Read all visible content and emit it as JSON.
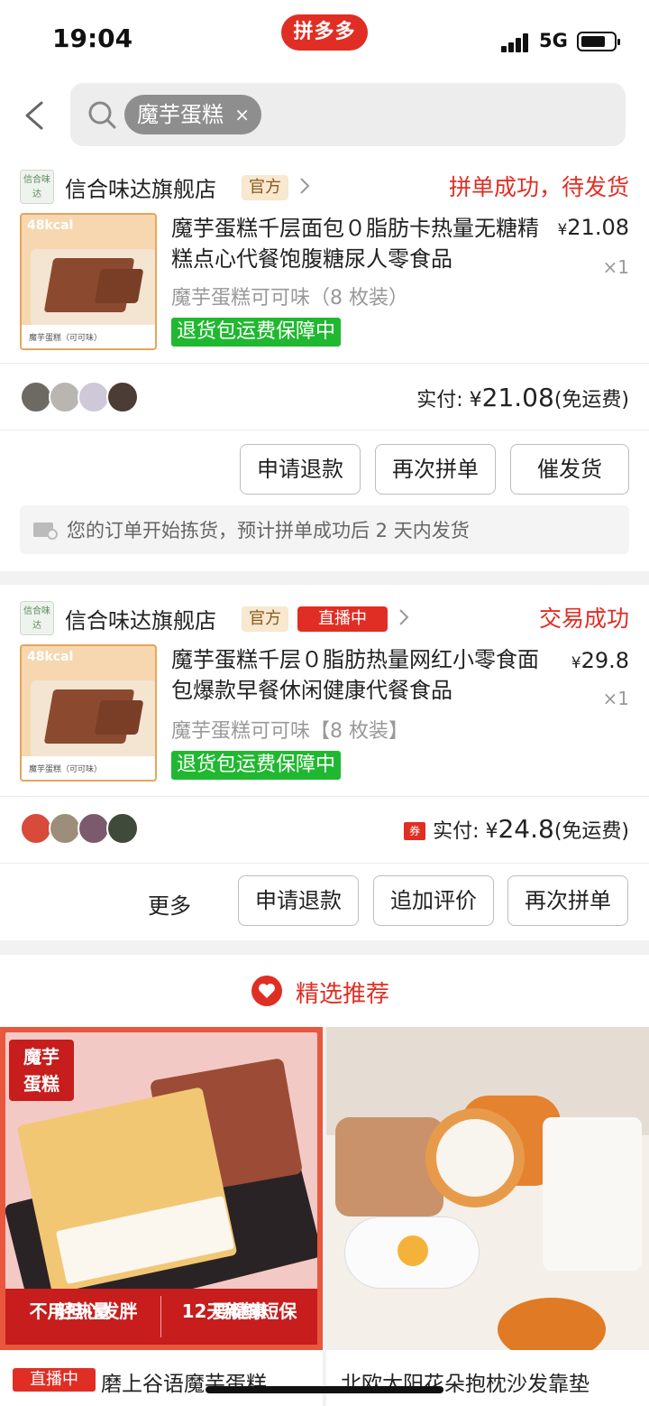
{
  "status_bar": {
    "time": "19:04",
    "app_badge": "拼多多",
    "network": "5G"
  },
  "search": {
    "chip_text": "魔芋蛋糕",
    "chip_clear": "×"
  },
  "orders": [
    {
      "store_name": "信合味达旗舰店",
      "store_logo_text": "信合味达",
      "official_tag": "官方",
      "status": "拼单成功，待发货",
      "image_kcal": "48kcal",
      "image_caption": "魔芋蛋糕（可可味）",
      "title": "魔芋蛋糕千层面包０脂肪卡热量无糖精糕点心代餐饱腹糖尿人零食品",
      "spec": "魔芋蛋糕可可味（8 枚装）",
      "guarantee": "退货包运费保障中",
      "price_symbol": "¥",
      "price": "21.08",
      "quantity": "×1",
      "paid_label": "实付: ¥",
      "paid_amount": "21.08",
      "shipping_note": "(免运费)",
      "buttons": [
        "申请退款",
        "再次拼单",
        "催发货"
      ],
      "notice": "您的订单开始拣货，预计拼单成功后 2 天内发货"
    },
    {
      "store_name": "信合味达旗舰店",
      "store_logo_text": "信合味达",
      "official_tag": "官方",
      "live_tag": "直播中",
      "status": "交易成功",
      "image_kcal": "48kcal",
      "image_caption": "魔芋蛋糕（可可味）",
      "title": "魔芋蛋糕千层０脂肪热量网红小零食面包爆款早餐休闲健康代餐食品",
      "spec": "魔芋蛋糕可可味【8 枚装】",
      "guarantee": "退货包运费保障中",
      "price_symbol": "¥",
      "price": "29.8",
      "quantity": "×1",
      "coupon_tag": "券",
      "paid_label": "实付: ¥",
      "paid_amount": "24.8",
      "shipping_note": "(免运费)",
      "more_label": "更多",
      "buttons": [
        "申请退款",
        "追加评价",
        "再次拼单"
      ]
    }
  ],
  "recommend": {
    "title": "精选推荐",
    "items": [
      {
        "badge_line1": "魔芋",
        "badge_line2": "蛋糕",
        "ribbon_left_1": "轻热量",
        "ribbon_left_2": "不用担心发胖",
        "ribbon_right_1": "要健康",
        "ribbon_right_2": "12天新鲜短保",
        "live_tag": "直播中",
        "title": "磨上谷语魔芋蛋糕"
      },
      {
        "title": "北欧太阳花朵抱枕沙发靠垫"
      }
    ]
  },
  "colors": {
    "accent": "#e02e24",
    "guarantee_green": "#20b830",
    "official_tag_bg": "#f7e8cf"
  },
  "icons": [
    "back-arrow-icon",
    "search-icon",
    "chevron-right-icon",
    "truck-icon",
    "heart-badge-icon"
  ]
}
